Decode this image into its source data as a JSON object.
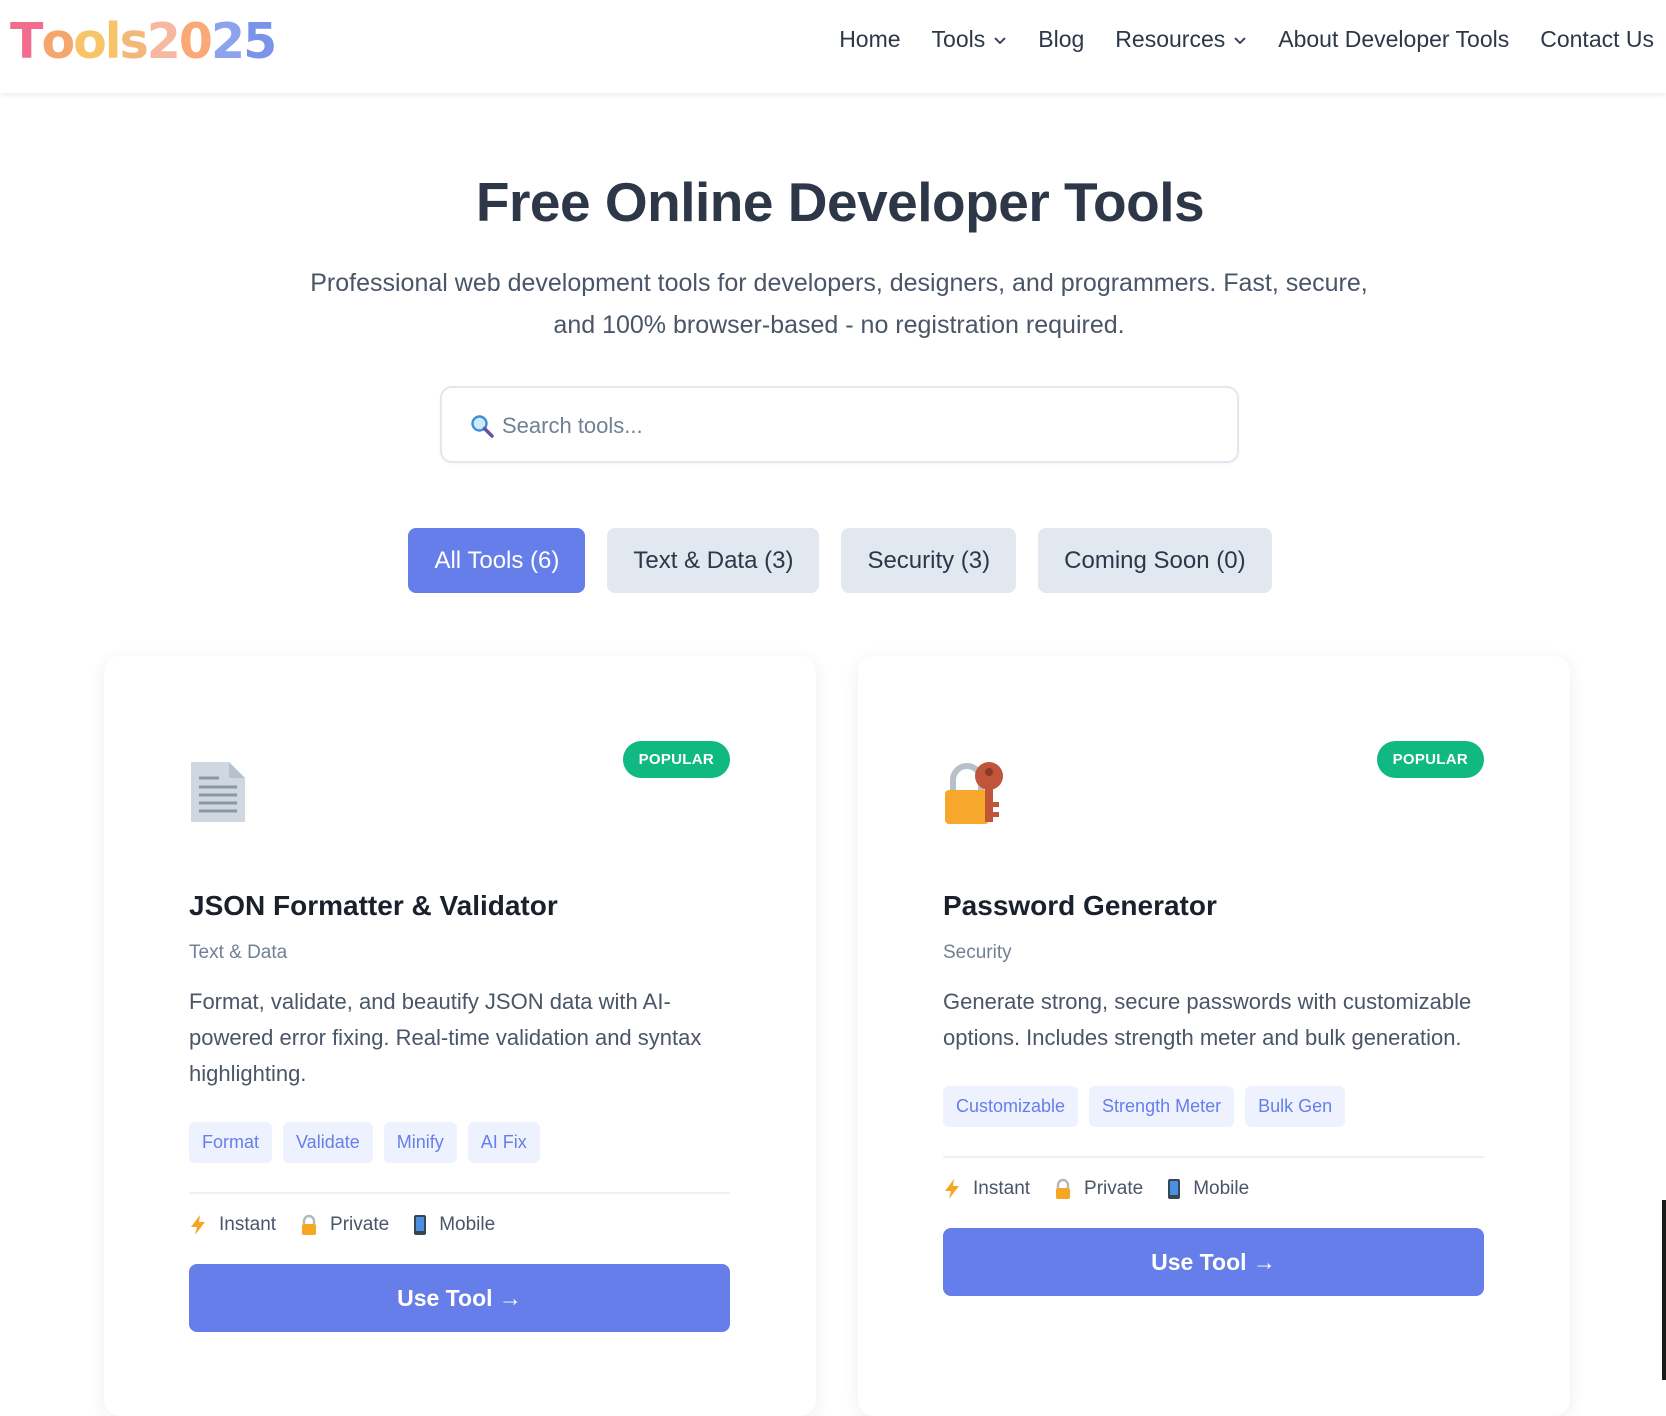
{
  "header": {
    "logo": "Tools2025",
    "nav": [
      {
        "label": "Home",
        "dropdown": false
      },
      {
        "label": "Tools",
        "dropdown": true
      },
      {
        "label": "Blog",
        "dropdown": false
      },
      {
        "label": "Resources",
        "dropdown": true
      },
      {
        "label": "About Developer Tools",
        "dropdown": false
      },
      {
        "label": "Contact Us",
        "dropdown": false
      }
    ]
  },
  "hero": {
    "title": "Free Online Developer Tools",
    "subtitle": "Professional web development tools for developers, designers, and programmers. Fast, secure, and 100% browser-based - no registration required."
  },
  "search": {
    "placeholder": "Search tools..."
  },
  "filters": [
    {
      "label": "All Tools (6)",
      "active": true
    },
    {
      "label": "Text & Data (3)",
      "active": false
    },
    {
      "label": "Security (3)",
      "active": false
    },
    {
      "label": "Coming Soon (0)",
      "active": false
    }
  ],
  "cards": [
    {
      "icon": "document-icon",
      "badge": "POPULAR",
      "title": "JSON Formatter & Validator",
      "category": "Text & Data",
      "description": "Format, validate, and beautify JSON data with AI-powered error fixing. Real-time validation and syntax highlighting.",
      "tags": [
        "Format",
        "Validate",
        "Minify",
        "AI Fix"
      ],
      "features": [
        "Instant",
        "Private",
        "Mobile"
      ],
      "button": "Use Tool →"
    },
    {
      "icon": "lock-key-icon",
      "badge": "POPULAR",
      "title": "Password Generator",
      "category": "Security",
      "description": "Generate strong, secure passwords with customizable options. Includes strength meter and bulk generation.",
      "tags": [
        "Customizable",
        "Strength Meter",
        "Bulk Gen"
      ],
      "features": [
        "Instant",
        "Private",
        "Mobile"
      ],
      "button": "Use Tool →"
    }
  ],
  "colors": {
    "primary": "#667eea",
    "badge": "#10b981",
    "logo": [
      "#f56a8c",
      "#f7c567",
      "#7b93e8"
    ]
  }
}
